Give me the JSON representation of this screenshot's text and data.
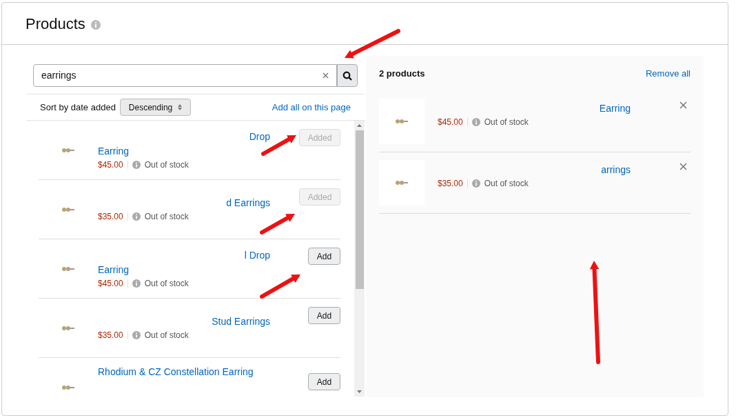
{
  "header": {
    "title": "Products"
  },
  "search": {
    "value": "earrings"
  },
  "sort": {
    "label": "Sort by date added",
    "value": "Descending"
  },
  "add_all": "Add all on this page",
  "results": [
    {
      "title_lines": [
        {
          "text": "Drop",
          "partial": true
        },
        {
          "text": "Earring",
          "partial": false
        }
      ],
      "price": "$45.00",
      "stock": "Out of stock",
      "button": "Added",
      "added": true
    },
    {
      "title_lines": [
        {
          "text": "d Earrings",
          "partial": true
        }
      ],
      "price": "$35.00",
      "stock": "Out of stock",
      "button": "Added",
      "added": true
    },
    {
      "title_lines": [
        {
          "text": "l Drop",
          "partial": true
        },
        {
          "text": "Earring",
          "partial": false
        }
      ],
      "price": "$45.00",
      "stock": "Out of stock",
      "button": "Add",
      "added": false
    },
    {
      "title_lines": [
        {
          "text": "Stud Earrings",
          "partial": true
        }
      ],
      "price": "$35.00",
      "stock": "Out of stock",
      "button": "Add",
      "added": false
    },
    {
      "title_lines": [
        {
          "text": "Rhodium & CZ Constellation Earring",
          "partial": false
        }
      ],
      "button": "Add",
      "added": false
    }
  ],
  "selected": {
    "count": "2 products",
    "remove_all": "Remove all",
    "items": [
      {
        "title": "Earring",
        "price": "$45.00",
        "stock": "Out of stock"
      },
      {
        "title": "arrings",
        "price": "$35.00",
        "stock": "Out of stock"
      }
    ]
  }
}
